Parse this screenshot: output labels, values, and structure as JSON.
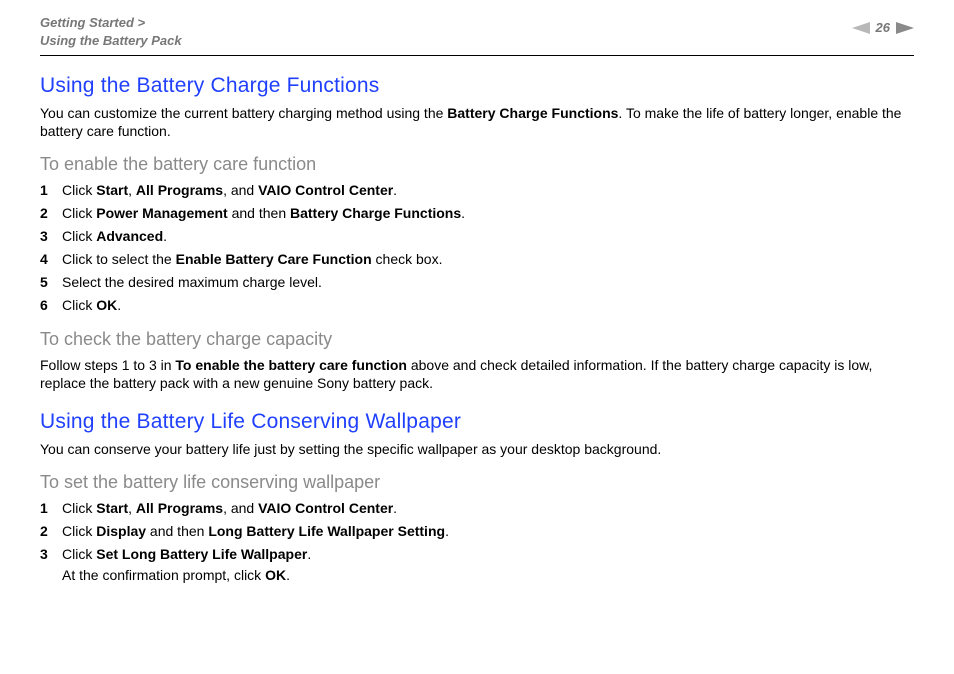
{
  "breadcrumb": {
    "line1": "Getting Started >",
    "line2": "Using the Battery Pack"
  },
  "page_number": "26",
  "h_charge": "Using the Battery Charge Functions",
  "p_charge_intro_1": "You can customize the current battery charging method using the ",
  "p_charge_intro_b": "Battery Charge Functions",
  "p_charge_intro_2": ". To make the life of battery longer, enable the battery care function.",
  "h_enable": "To enable the battery care function",
  "steps_enable": [
    {
      "n": "1",
      "pre": "Click ",
      "b1": "Start",
      "mid1": ", ",
      "b2": "All Programs",
      "mid2": ", and ",
      "b3": "VAIO Control Center",
      "post": "."
    },
    {
      "n": "2",
      "pre": "Click ",
      "b1": "Power Management",
      "mid1": " and then ",
      "b2": "Battery Charge Functions",
      "post": "."
    },
    {
      "n": "3",
      "pre": "Click ",
      "b1": "Advanced",
      "post": "."
    },
    {
      "n": "4",
      "pre": "Click to select the ",
      "b1": "Enable Battery Care Function",
      "post": " check box."
    },
    {
      "n": "5",
      "pre": "Select the desired maximum charge level.",
      "b1": "",
      "post": ""
    },
    {
      "n": "6",
      "pre": "Click ",
      "b1": "OK",
      "post": "."
    }
  ],
  "h_check": "To check the battery charge capacity",
  "p_check_1": "Follow steps 1 to 3 in ",
  "p_check_b": "To enable the battery care function",
  "p_check_2": " above and check detailed information. If the battery charge capacity is low, replace the battery pack with a new genuine Sony battery pack.",
  "h_wall": "Using the Battery Life Conserving Wallpaper",
  "p_wall": "You can conserve your battery life just by setting the specific wallpaper as your desktop background.",
  "h_setwall": "To set the battery life conserving wallpaper",
  "steps_wall": [
    {
      "n": "1",
      "pre": "Click ",
      "b1": "Start",
      "mid1": ", ",
      "b2": "All Programs",
      "mid2": ", and ",
      "b3": "VAIO Control Center",
      "post": "."
    },
    {
      "n": "2",
      "pre": "Click ",
      "b1": "Display",
      "mid1": " and then ",
      "b2": "Long Battery Life Wallpaper Setting",
      "post": "."
    },
    {
      "n": "3",
      "pre": "Click ",
      "b1": "Set Long Battery Life Wallpaper",
      "post": ".",
      "sub_pre": "At the confirmation prompt, click ",
      "sub_b": "OK",
      "sub_post": "."
    }
  ],
  "arrow_fill": "#8a8a8a"
}
